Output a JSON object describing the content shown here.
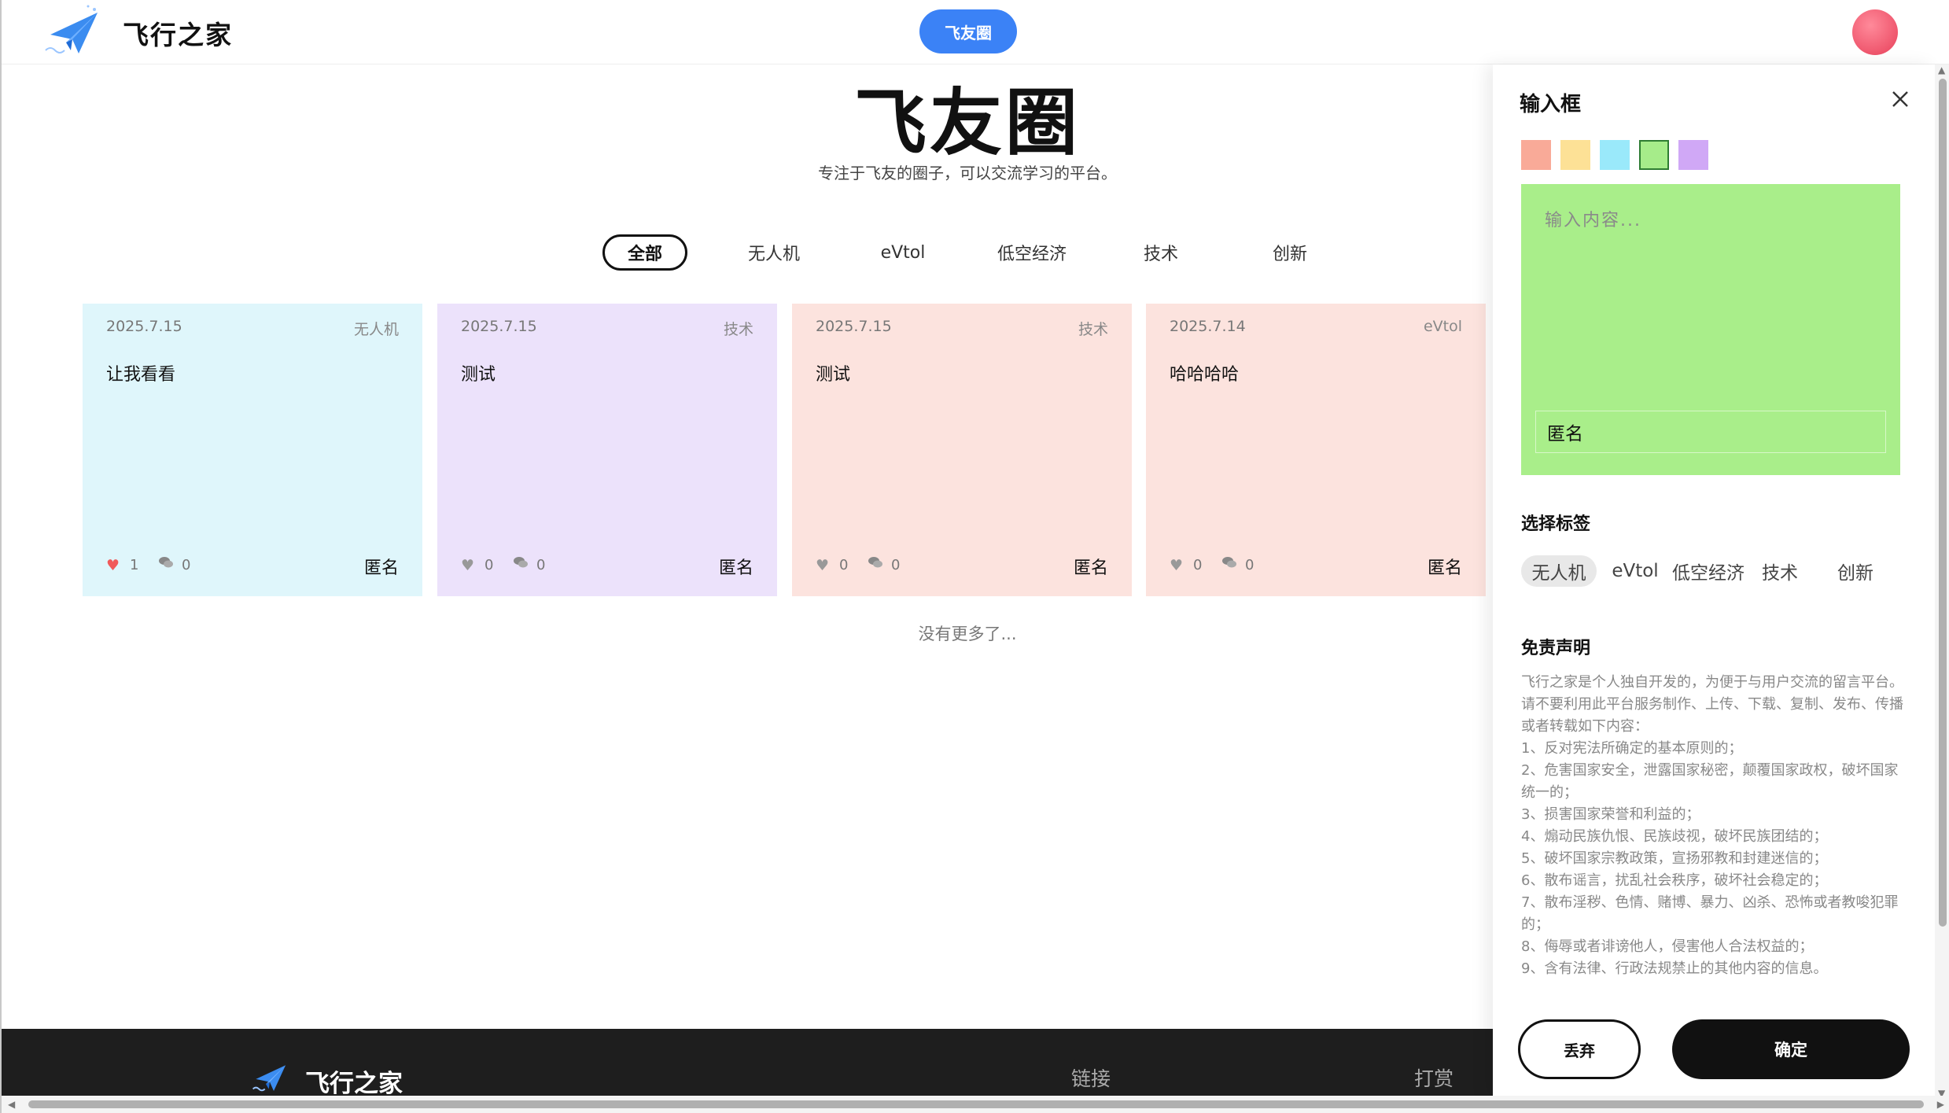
{
  "header": {
    "brand": "飞行之家",
    "center_button": "飞友圈"
  },
  "hero": {
    "title": "飞友圈",
    "subtitle": "专注于飞友的圈子，可以交流学习的平台。"
  },
  "filters": [
    {
      "label": "全部",
      "active": true
    },
    {
      "label": "无人机",
      "active": false
    },
    {
      "label": "eVtol",
      "active": false
    },
    {
      "label": "低空经济",
      "active": false
    },
    {
      "label": "技术",
      "active": false
    },
    {
      "label": "创新",
      "active": false
    }
  ],
  "cards": [
    {
      "date": "2025.7.15",
      "tag": "无人机",
      "content": "让我看看",
      "likes": "1",
      "comments": "0",
      "author": "匿名",
      "bg": "#dff6fb",
      "liked": true
    },
    {
      "date": "2025.7.15",
      "tag": "技术",
      "content": "测试",
      "likes": "0",
      "comments": "0",
      "author": "匿名",
      "bg": "#ece2fb",
      "liked": false
    },
    {
      "date": "2025.7.15",
      "tag": "技术",
      "content": "测试",
      "likes": "0",
      "comments": "0",
      "author": "匿名",
      "bg": "#fce3de",
      "liked": false
    },
    {
      "date": "2025.7.14",
      "tag": "eVtol",
      "content": "哈哈哈哈",
      "likes": "0",
      "comments": "0",
      "author": "匿名",
      "bg": "#fce3de",
      "liked": false
    }
  ],
  "no_more": "没有更多了...",
  "footer": {
    "brand": "飞行之家",
    "links_label": "链接",
    "reward_label": "打赏"
  },
  "drawer": {
    "title": "输入框",
    "swatches": [
      "#f9aa98",
      "#fde196",
      "#9ae9fa",
      "#a6ec8a",
      "#d0a8f6"
    ],
    "selected_swatch": 3,
    "content_placeholder": "输入内容...",
    "name_value": "匿名",
    "tags_title": "选择标签",
    "tags": [
      {
        "label": "无人机",
        "selected": true
      },
      {
        "label": "eVtol",
        "selected": false
      },
      {
        "label": "低空经济",
        "selected": false
      },
      {
        "label": "技术",
        "selected": false
      },
      {
        "label": "创新",
        "selected": false
      }
    ],
    "disclaimer_title": "免责声明",
    "disclaimer_lines": [
      "飞行之家是个人独自开发的，为便于与用户交流的留言平台。请不要利用此平台服务制作、上传、下载、复制、发布、传播或者转载如下内容：",
      "1、反对宪法所确定的基本原则的；",
      "2、危害国家安全，泄露国家秘密，颠覆国家政权，破坏国家 统一的；",
      "3、损害国家荣誉和利益的；",
      "4、煽动民族仇恨、民族歧视，破坏民族团结的；",
      "5、破坏国家宗教政策，宣扬邪教和封建迷信的；",
      "6、散布谣言，扰乱社会秩序，破坏社会稳定的；",
      "7、散布淫秽、色情、赌博、暴力、凶杀、恐怖或者教唆犯罪的；",
      "8、侮辱或者诽谤他人，侵害他人合法权益的；",
      "9、含有法律、行政法规禁止的其他内容的信息。"
    ],
    "discard_label": "丢弃",
    "confirm_label": "确定"
  },
  "colors": {
    "accent": "#3b82f6",
    "footer_bg": "#1e1e1e",
    "heart_liked": "#f05a5a"
  }
}
